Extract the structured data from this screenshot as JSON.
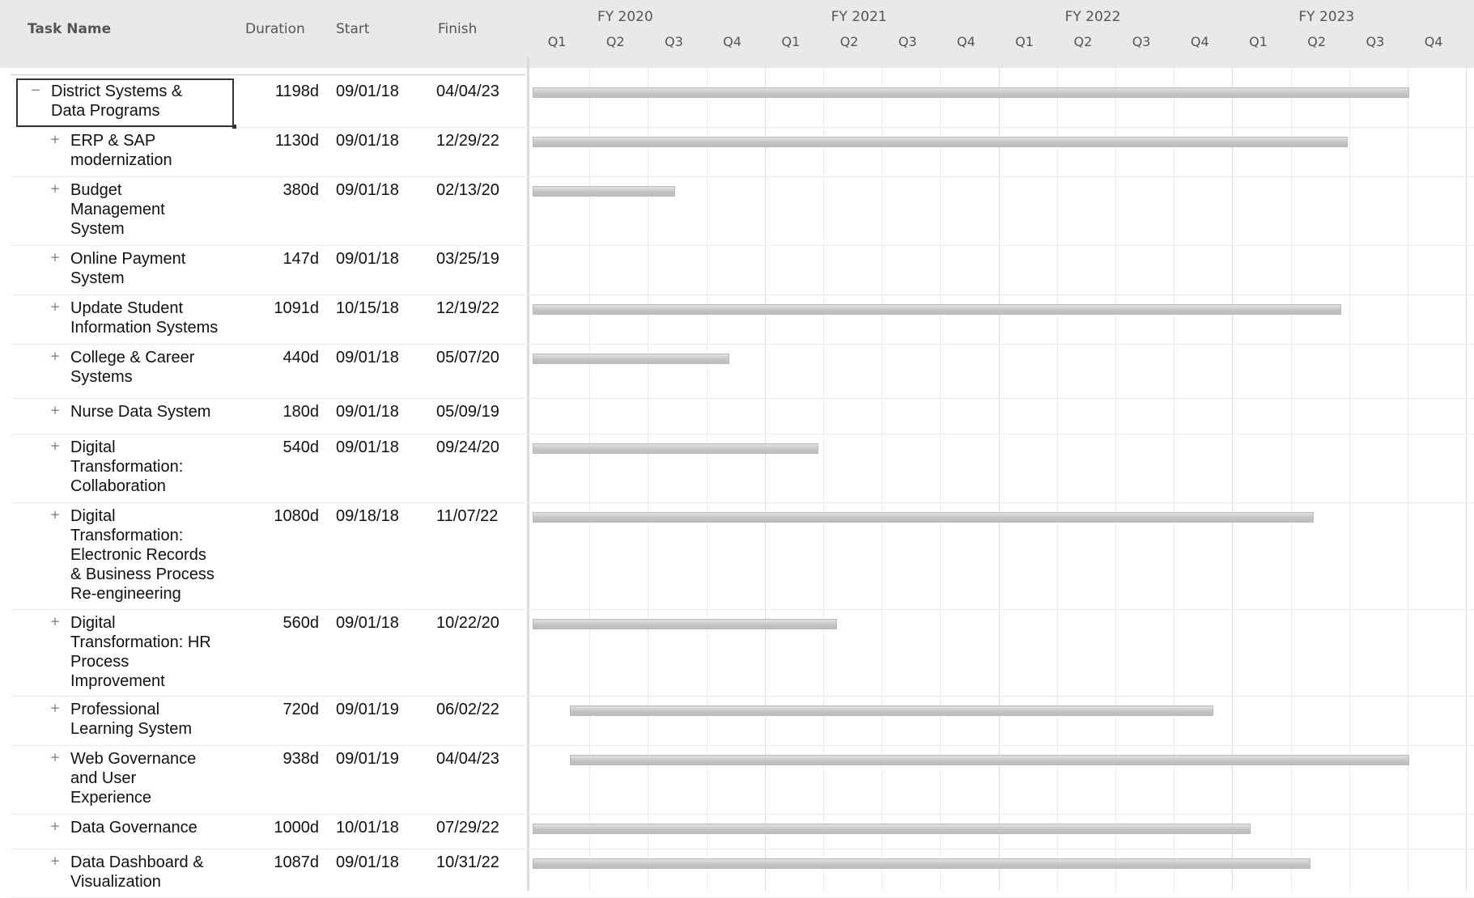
{
  "columns": {
    "task_name": "Task Name",
    "duration": "Duration",
    "start": "Start",
    "finish": "Finish"
  },
  "fiscal_years": [
    "FY 2020",
    "FY 2021",
    "FY 2022",
    "FY 2023"
  ],
  "quarters": [
    "Q1",
    "Q2",
    "Q3",
    "Q4"
  ],
  "toggle_icons": {
    "collapse": "minus-icon",
    "expand": "plus-icon"
  },
  "colors": {
    "header_bg": "#e9e9e9",
    "bar": "#c4c4c4",
    "grid": "#ececec"
  },
  "tasks": [
    {
      "name": "District Systems & Data Programs",
      "lines": [
        "District Systems &",
        "Data Programs"
      ],
      "duration": "1198d",
      "start": "09/01/18",
      "finish": "04/04/23",
      "state": "collapse",
      "level": 0,
      "selected": true
    },
    {
      "name": "ERP & SAP modernization",
      "lines": [
        "ERP & SAP",
        "modernization"
      ],
      "duration": "1130d",
      "start": "09/01/18",
      "finish": "12/29/22",
      "state": "expand",
      "level": 1
    },
    {
      "name": "Budget Management System",
      "lines": [
        "Budget",
        "Management",
        "System"
      ],
      "duration": "380d",
      "start": "09/01/18",
      "finish": "02/13/20",
      "state": "expand",
      "level": 1
    },
    {
      "name": "Online Payment System",
      "lines": [
        "Online Payment",
        "System"
      ],
      "duration": "147d",
      "start": "09/01/18",
      "finish": "03/25/19",
      "state": "expand",
      "level": 1
    },
    {
      "name": "Update Student Information Systems",
      "lines": [
        "Update Student",
        "Information Systems"
      ],
      "duration": "1091d",
      "start": "10/15/18",
      "finish": "12/19/22",
      "state": "expand",
      "level": 1
    },
    {
      "name": "College & Career Systems",
      "lines": [
        "College & Career",
        "Systems"
      ],
      "duration": "440d",
      "start": "09/01/18",
      "finish": "05/07/20",
      "state": "expand",
      "level": 1
    },
    {
      "name": "Nurse Data System",
      "lines": [
        "Nurse Data System"
      ],
      "duration": "180d",
      "start": "09/01/18",
      "finish": "05/09/19",
      "state": "expand",
      "level": 1
    },
    {
      "name": "Digital Transformation: Collaboration",
      "lines": [
        "Digital",
        "Transformation:",
        "Collaboration"
      ],
      "duration": "540d",
      "start": "09/01/18",
      "finish": "09/24/20",
      "state": "expand",
      "level": 1
    },
    {
      "name": "Digital Transformation: Electronic Records & Business Process Re-engineering",
      "lines": [
        "Digital",
        "Transformation:",
        "Electronic Records",
        "& Business Process",
        "Re-engineering"
      ],
      "duration": "1080d",
      "start": "09/18/18",
      "finish": "11/07/22",
      "state": "expand",
      "level": 1
    },
    {
      "name": "Digital Transformation: HR Process Improvement",
      "lines": [
        "Digital",
        "Transformation: HR",
        "Process",
        "Improvement"
      ],
      "duration": "560d",
      "start": "09/01/18",
      "finish": "10/22/20",
      "state": "expand",
      "level": 1
    },
    {
      "name": "Professional Learning System",
      "lines": [
        "Professional",
        "Learning System"
      ],
      "duration": "720d",
      "start": "09/01/19",
      "finish": "06/02/22",
      "state": "expand",
      "level": 1
    },
    {
      "name": "Web Governance and User Experience",
      "lines": [
        "Web Governance",
        "and User",
        "Experience"
      ],
      "duration": "938d",
      "start": "09/01/19",
      "finish": "04/04/23",
      "state": "expand",
      "level": 1
    },
    {
      "name": "Data Governance",
      "lines": [
        "Data Governance"
      ],
      "duration": "1000d",
      "start": "10/01/18",
      "finish": "07/29/22",
      "state": "expand",
      "level": 1
    },
    {
      "name": "Data Dashboard & Visualization",
      "lines": [
        "Data Dashboard &",
        "Visualization"
      ],
      "duration": "1087d",
      "start": "09/01/18",
      "finish": "10/31/22",
      "state": "expand",
      "level": 1
    }
  ]
}
